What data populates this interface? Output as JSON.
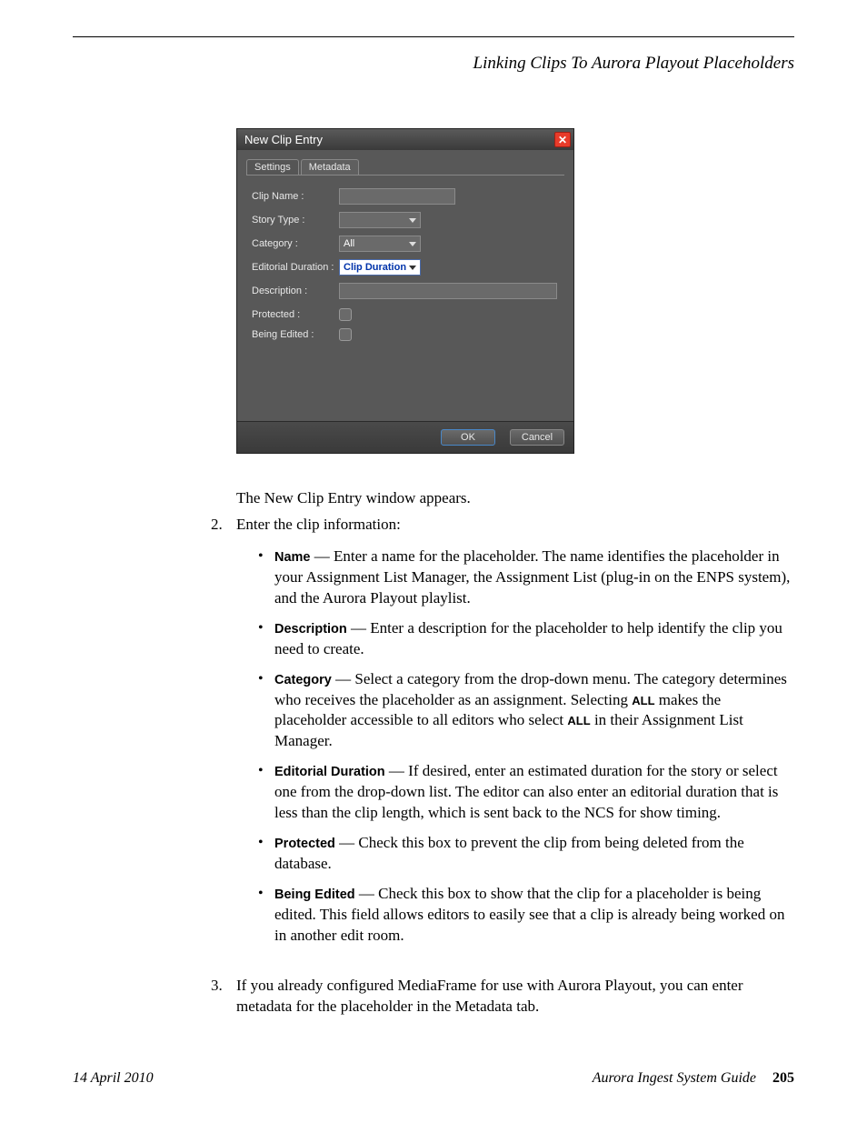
{
  "header": {
    "title": "Linking Clips To Aurora Playout Placeholders"
  },
  "dialog": {
    "window_title": "New Clip Entry",
    "tabs": {
      "settings": "Settings",
      "metadata": "Metadata"
    },
    "labels": {
      "clip_name": "Clip Name :",
      "story_type": "Story Type :",
      "category": "Category :",
      "editorial_duration": "Editorial Duration :",
      "description": "Description :",
      "protected": "Protected :",
      "being_edited": "Being Edited :"
    },
    "values": {
      "clip_name": "",
      "story_type": "",
      "category": "All",
      "editorial_duration": "Clip Duration",
      "description": ""
    },
    "buttons": {
      "ok": "OK",
      "cancel": "Cancel"
    }
  },
  "text": {
    "p1": "The New Clip Entry window appears.",
    "step2_intro": "Enter the clip information:",
    "step2_num": "2.",
    "step3_num": "3.",
    "b_name_term": "Name",
    "b_name_body": " — Enter a name for the placeholder. The name identifies the placeholder in your Assignment List Manager, the Assignment List (plug-in on the ENPS system), and the Aurora Playout playlist.",
    "b_desc_term": "Description",
    "b_desc_body": " — Enter a description for the placeholder to help identify the clip you need to create.",
    "b_cat_term": "Category",
    "b_cat_body_a": " — Select a category from the drop-down menu. The category determines who receives the placeholder as an assignment. Selecting ",
    "b_cat_all1": "ALL",
    "b_cat_body_b": " makes the placeholder accessible to all editors who select ",
    "b_cat_all2": "ALL",
    "b_cat_body_c": " in their Assignment List Manager.",
    "b_ed_term": "Editorial Duration",
    "b_ed_body": " — If desired, enter an estimated duration for the story or select one from the drop-down list. The editor can also enter an editorial duration that is less than the clip length, which is sent back to the NCS for show timing.",
    "b_prot_term": "Protected",
    "b_prot_body": " — Check this box to prevent the clip from being deleted from the database.",
    "b_be_term": "Being Edited",
    "b_be_body": " — Check this box to show that the clip for a placeholder is being edited. This field allows editors to easily see that a clip is already being worked on in another edit room.",
    "step3": "If you already configured MediaFrame for use with Aurora Playout, you can enter metadata for the placeholder in the Metadata tab."
  },
  "footer": {
    "date": "14 April 2010",
    "guide": "Aurora Ingest System Guide",
    "page": "205"
  }
}
